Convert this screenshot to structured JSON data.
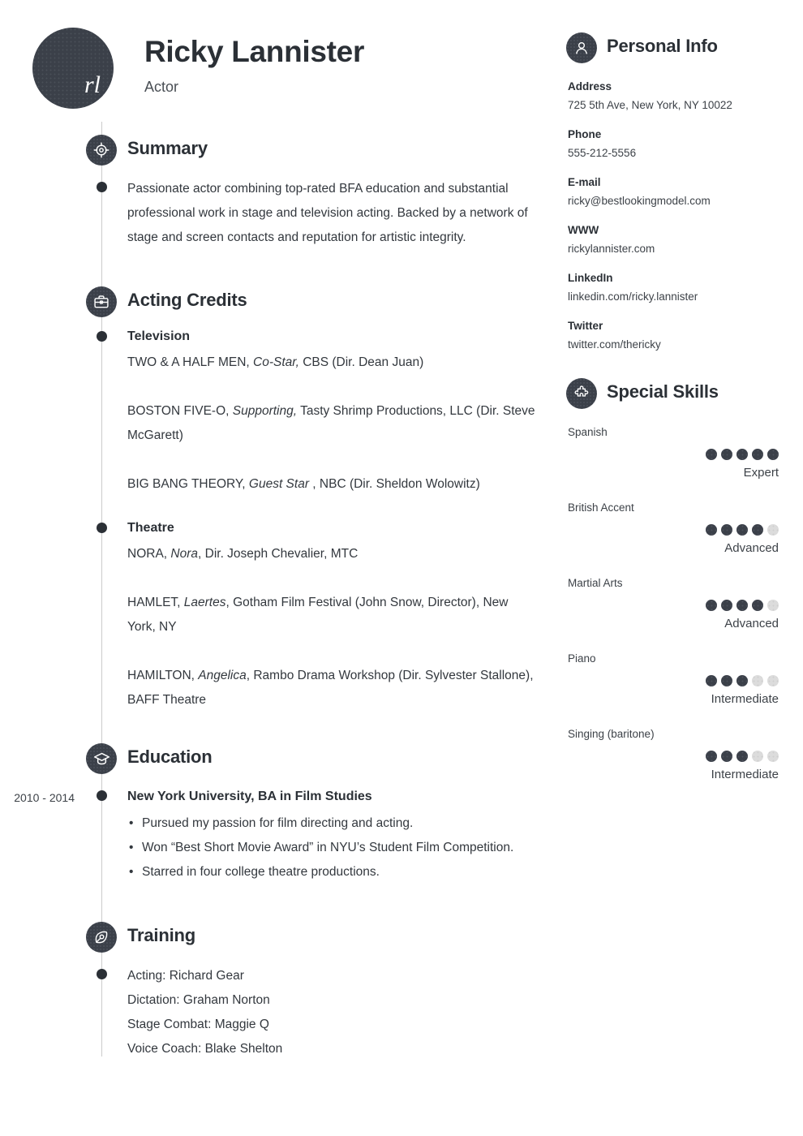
{
  "header": {
    "avatar_initials": "rl",
    "name": "Ricky Lannister",
    "job_title": "Actor"
  },
  "sections": {
    "summary": {
      "title": "Summary",
      "icon": "target-icon",
      "text": "Passionate actor combining top-rated BFA education and substantial professional work in stage and television acting. Backed by a network of stage and screen contacts and reputation for artistic integrity."
    },
    "acting_credits": {
      "title": "Acting Credits",
      "icon": "briefcase-icon",
      "groups": [
        {
          "name": "Television",
          "credits": [
            {
              "pre": "TWO & A HALF MEN, ",
              "em": "Co-Star,",
              "post": " CBS (Dir. Dean Juan)"
            },
            {
              "pre": "BOSTON FIVE-O, ",
              "em": "Supporting,",
              "post": " Tasty Shrimp Productions, LLC (Dir. Steve McGarett)"
            },
            {
              "pre": "BIG BANG THEORY, ",
              "em": "Guest Star ",
              "post": ", NBC (Dir. Sheldon Wolowitz)"
            }
          ]
        },
        {
          "name": "Theatre",
          "credits": [
            {
              "pre": "NORA, ",
              "em": "Nora",
              "post": ", Dir. Joseph Chevalier, MTC"
            },
            {
              "pre": "HAMLET, ",
              "em": "Laertes",
              "post": ", Gotham Film Festival (John Snow, Director), New York, NY"
            },
            {
              "pre": "HAMILTON, ",
              "em": "Angelica",
              "post": ", Rambo Drama Workshop (Dir. Sylvester Stallone), BAFF  Theatre"
            }
          ]
        }
      ]
    },
    "education": {
      "title": "Education",
      "icon": "graduation-cap-icon",
      "date": "2010 - 2014",
      "school": "New York University, BA in Film Studies",
      "bullets": [
        "Pursued my passion for film directing and acting.",
        "Won “Best Short Movie Award” in NYU’s Student Film Competition.",
        "Starred in four college theatre productions."
      ]
    },
    "training": {
      "title": "Training",
      "icon": "pen-nib-icon",
      "lines": [
        "Acting: Richard Gear",
        "Dictation: Graham Norton",
        "Stage Combat: Maggie Q",
        "Voice Coach: Blake Shelton"
      ]
    }
  },
  "personal_info": {
    "title": "Personal Info",
    "icon": "person-icon",
    "fields": [
      {
        "label": "Address",
        "value": "725 5th Ave, New York, NY 10022"
      },
      {
        "label": "Phone",
        "value": "555-212-5556"
      },
      {
        "label": "E-mail",
        "value": "ricky@bestlookingmodel.com"
      },
      {
        "label": "WWW",
        "value": "rickylannister.com"
      },
      {
        "label": "LinkedIn",
        "value": "linkedin.com/ricky.lannister"
      },
      {
        "label": "Twitter",
        "value": "twitter.com/thericky"
      }
    ]
  },
  "special_skills": {
    "title": "Special Skills",
    "icon": "puzzle-piece-icon",
    "max_dots": 5,
    "items": [
      {
        "name": "Spanish",
        "rating": 5,
        "level": "Expert"
      },
      {
        "name": "British Accent",
        "rating": 4,
        "level": "Advanced"
      },
      {
        "name": "Martial Arts",
        "rating": 4,
        "level": "Advanced"
      },
      {
        "name": "Piano",
        "rating": 3,
        "level": "Intermediate"
      },
      {
        "name": "Singing (baritone)",
        "rating": 3,
        "level": "Intermediate"
      }
    ]
  },
  "colors": {
    "ink": "#2b3036",
    "body_text": "#33383e",
    "badge": "#3b4049",
    "rail": "#cbcbcb",
    "dot_off": "#dcdcdc"
  }
}
